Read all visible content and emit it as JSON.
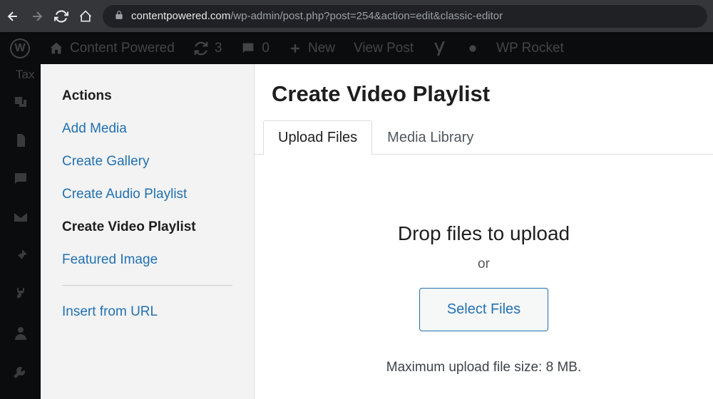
{
  "browser": {
    "url_domain": "contentpowered.com",
    "url_path": "/wp-admin/post.php?post=254&action=edit&classic-editor"
  },
  "adminbar": {
    "site_name": "Content Powered",
    "updates": "3",
    "comments": "0",
    "new": "New",
    "view": "View Post",
    "wprocket": "WP Rocket"
  },
  "wp_menu_label": "Tax",
  "sidebar": {
    "heading": "Actions",
    "items": [
      {
        "label": "Add Media",
        "active": false
      },
      {
        "label": "Create Gallery",
        "active": false
      },
      {
        "label": "Create Audio Playlist",
        "active": false
      },
      {
        "label": "Create Video Playlist",
        "active": true
      },
      {
        "label": "Featured Image",
        "active": false
      }
    ],
    "insert_url": "Insert from URL"
  },
  "main": {
    "title": "Create Video Playlist",
    "tabs": [
      {
        "label": "Upload Files",
        "active": true
      },
      {
        "label": "Media Library",
        "active": false
      }
    ],
    "drop_text": "Drop files to upload",
    "or_text": "or",
    "select_button": "Select Files",
    "max_size": "Maximum upload file size: 8 MB."
  }
}
